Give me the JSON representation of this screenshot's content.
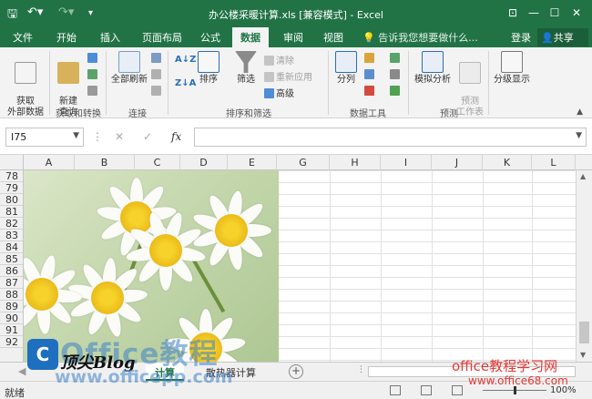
{
  "window": {
    "title": "办公楼采暖计算.xls  [兼容模式] - Excel",
    "quick_access": [
      "save",
      "undo",
      "redo",
      "customize"
    ]
  },
  "tabs": [
    {
      "label": "文件"
    },
    {
      "label": "开始"
    },
    {
      "label": "插入"
    },
    {
      "label": "页面布局"
    },
    {
      "label": "公式"
    },
    {
      "label": "数据",
      "active": true
    },
    {
      "label": "审阅"
    },
    {
      "label": "视图"
    }
  ],
  "tell_me": "告诉我您想要做什么...",
  "login": "登录",
  "share": "共享",
  "ribbon": {
    "get_external": "获取\n外部数据",
    "new_query": "新建\n查询",
    "group_get_transform": "获取和转换",
    "refresh_all": "全部刷新",
    "group_connections": "连接",
    "sort": "排序",
    "filter": "筛选",
    "clear": "清除",
    "reapply": "重新应用",
    "advanced": "高级",
    "group_sort_filter": "排序和筛选",
    "text_to_columns": "分列",
    "group_data_tools": "数据工具",
    "what_if": "模拟分析",
    "forecast_sheet": "预测\n工作表",
    "group_forecast": "预测",
    "outline": "分级显示"
  },
  "formula_bar": {
    "name_box": "I75",
    "cancel": "✕",
    "enter": "✓",
    "fx": "fx",
    "value": ""
  },
  "columns": [
    "A",
    "B",
    "C",
    "D",
    "E",
    "G",
    "H",
    "I",
    "J",
    "K",
    "L"
  ],
  "rows": [
    "78",
    "79",
    "80",
    "81",
    "82",
    "83",
    "84",
    "85",
    "86",
    "87",
    "88",
    "89",
    "90",
    "91",
    "92"
  ],
  "sheets": [
    {
      "label": "计算"
    },
    {
      "label": "散热器计算"
    }
  ],
  "status": {
    "ready": "就绪",
    "zoom": "100%"
  },
  "watermarks": {
    "office_text": "Office教程",
    "logo_letter": "C",
    "blog_text": "顶尖Blog",
    "url1": "www.officepp.com",
    "red_text": "office教程学习网",
    "red_url": "www.office68.com"
  },
  "colors": {
    "excel_green": "#217346",
    "ribbon_bg": "#f3f3f3",
    "watermark_red": "#e53935"
  }
}
